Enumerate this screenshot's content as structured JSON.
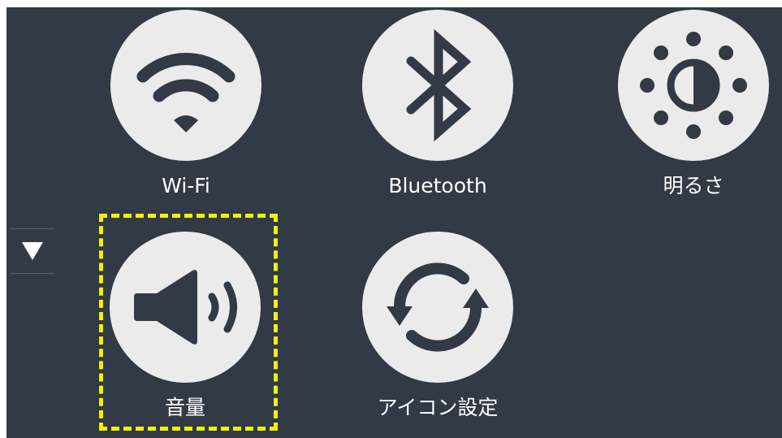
{
  "settings_grid": {
    "tiles": [
      {
        "label": "Wi-Fi",
        "icon": "wifi-icon"
      },
      {
        "label": "Bluetooth",
        "icon": "bluetooth-icon"
      },
      {
        "label": "明るさ",
        "icon": "brightness-icon"
      },
      {
        "label": "音量",
        "icon": "volume-icon"
      },
      {
        "label": "アイコン設定",
        "icon": "sync-icon"
      }
    ],
    "highlighted_tile": "音量"
  },
  "navigation": {
    "scroll_down_icon": "triangle-down-icon"
  },
  "colors": {
    "background": "#313a45",
    "tile_circle": "#ebebeb",
    "icon": "#313a45",
    "label": "#ffffff",
    "highlight": "#f2f200"
  }
}
